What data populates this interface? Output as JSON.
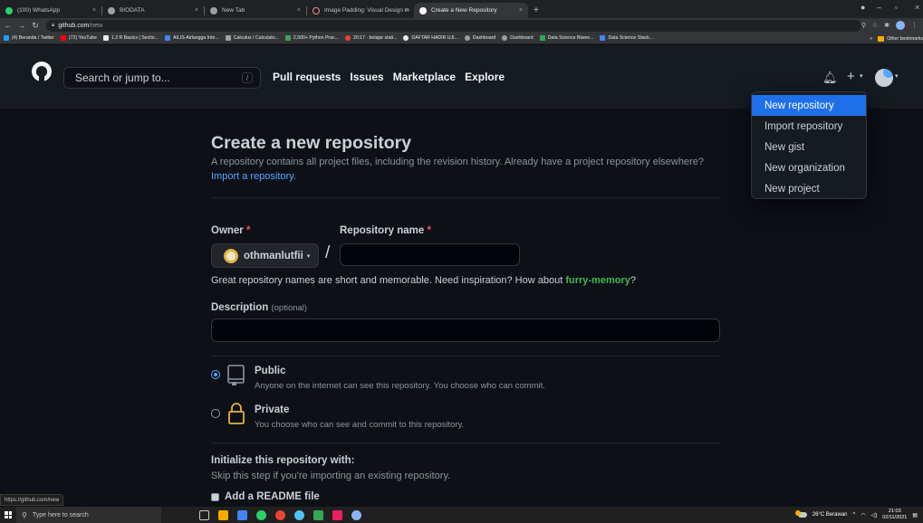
{
  "browser": {
    "tabs": [
      {
        "title": "(100) WhatsApp",
        "color": "#25d366"
      },
      {
        "title": "BIODATA",
        "color": "#9aa0a6"
      },
      {
        "title": "New Tab",
        "color": "#9aa0a6"
      },
      {
        "title": "Image Padding: Visual Design in",
        "color": "#f28b82"
      },
      {
        "title": "Create a New Repository",
        "color": "#ffffff"
      }
    ],
    "url_host": "github.com",
    "url_path": "/new",
    "bookmarks": [
      {
        "label": "(4) Beranda / Twitter",
        "color": "#1da1f2"
      },
      {
        "label": "(72) YouTube",
        "color": "#ff0000"
      },
      {
        "label": "1.2 R Basics | Sectio...",
        "color": "#e8eaed"
      },
      {
        "label": "AILIS-Airlangga Inte...",
        "color": "#4285f4"
      },
      {
        "label": "Calculus I Calculato...",
        "color": "#9aa0a6"
      },
      {
        "label": "2,500+ Python Prac...",
        "color": "#34a853"
      },
      {
        "label": "20:17 - belajar stati...",
        "color": "#ea4335"
      },
      {
        "label": "DAFTAR HADIR UJI...",
        "color": "#e8eaed"
      },
      {
        "label": "Dashboard",
        "color": "#9aa0a6"
      },
      {
        "label": "Dashboard",
        "color": "#9aa0a6"
      },
      {
        "label": "Data Science Biwee...",
        "color": "#34a853"
      },
      {
        "label": "Data Science Stack...",
        "color": "#4285f4"
      }
    ],
    "bookmarks_overflow": "»",
    "other_bookmarks": "Other bookmarks",
    "status_url": "https://github.com/new"
  },
  "header": {
    "search_placeholder": "Search or jump to...",
    "search_key": "/",
    "nav": [
      "Pull requests",
      "Issues",
      "Marketplace",
      "Explore"
    ]
  },
  "dropdown": {
    "items": [
      "New repository",
      "Import repository",
      "New gist",
      "New organization",
      "New project"
    ]
  },
  "main": {
    "title": "Create a new repository",
    "description": "A repository contains all project files, including the revision history. Already have a project repository elsewhere?",
    "import_link": "Import a repository.",
    "owner_label": "Owner",
    "owner_value": "othmanlutfii",
    "repo_label": "Repository name",
    "required_mark": "*",
    "slash": "/",
    "hint_prefix": "Great repository names are short and memorable. Need inspiration? How about",
    "hint_suggestion": "furry-memory",
    "hint_suffix": "?",
    "desc_label": "Description",
    "desc_optional": "(optional)",
    "public_title": "Public",
    "public_desc": "Anyone on the internet can see this repository. You choose who can commit.",
    "private_title": "Private",
    "private_desc": "You choose who can see and commit to this repository.",
    "init_title": "Initialize this repository with:",
    "init_desc": "Skip this step if you're importing an existing repository.",
    "readme_label": "Add a README file"
  },
  "taskbar": {
    "search_placeholder": "Type here to search",
    "weather": "26°C  Berawan",
    "time": "21:03",
    "date": "02/11/2021",
    "pinned_colors": [
      "#c8c8c8",
      "#f9ab00",
      "#4285f4",
      "#25d366",
      "#ea4335",
      "#4fc3f7",
      "#34a853",
      "#e91e63",
      "#8ab4f8"
    ]
  }
}
